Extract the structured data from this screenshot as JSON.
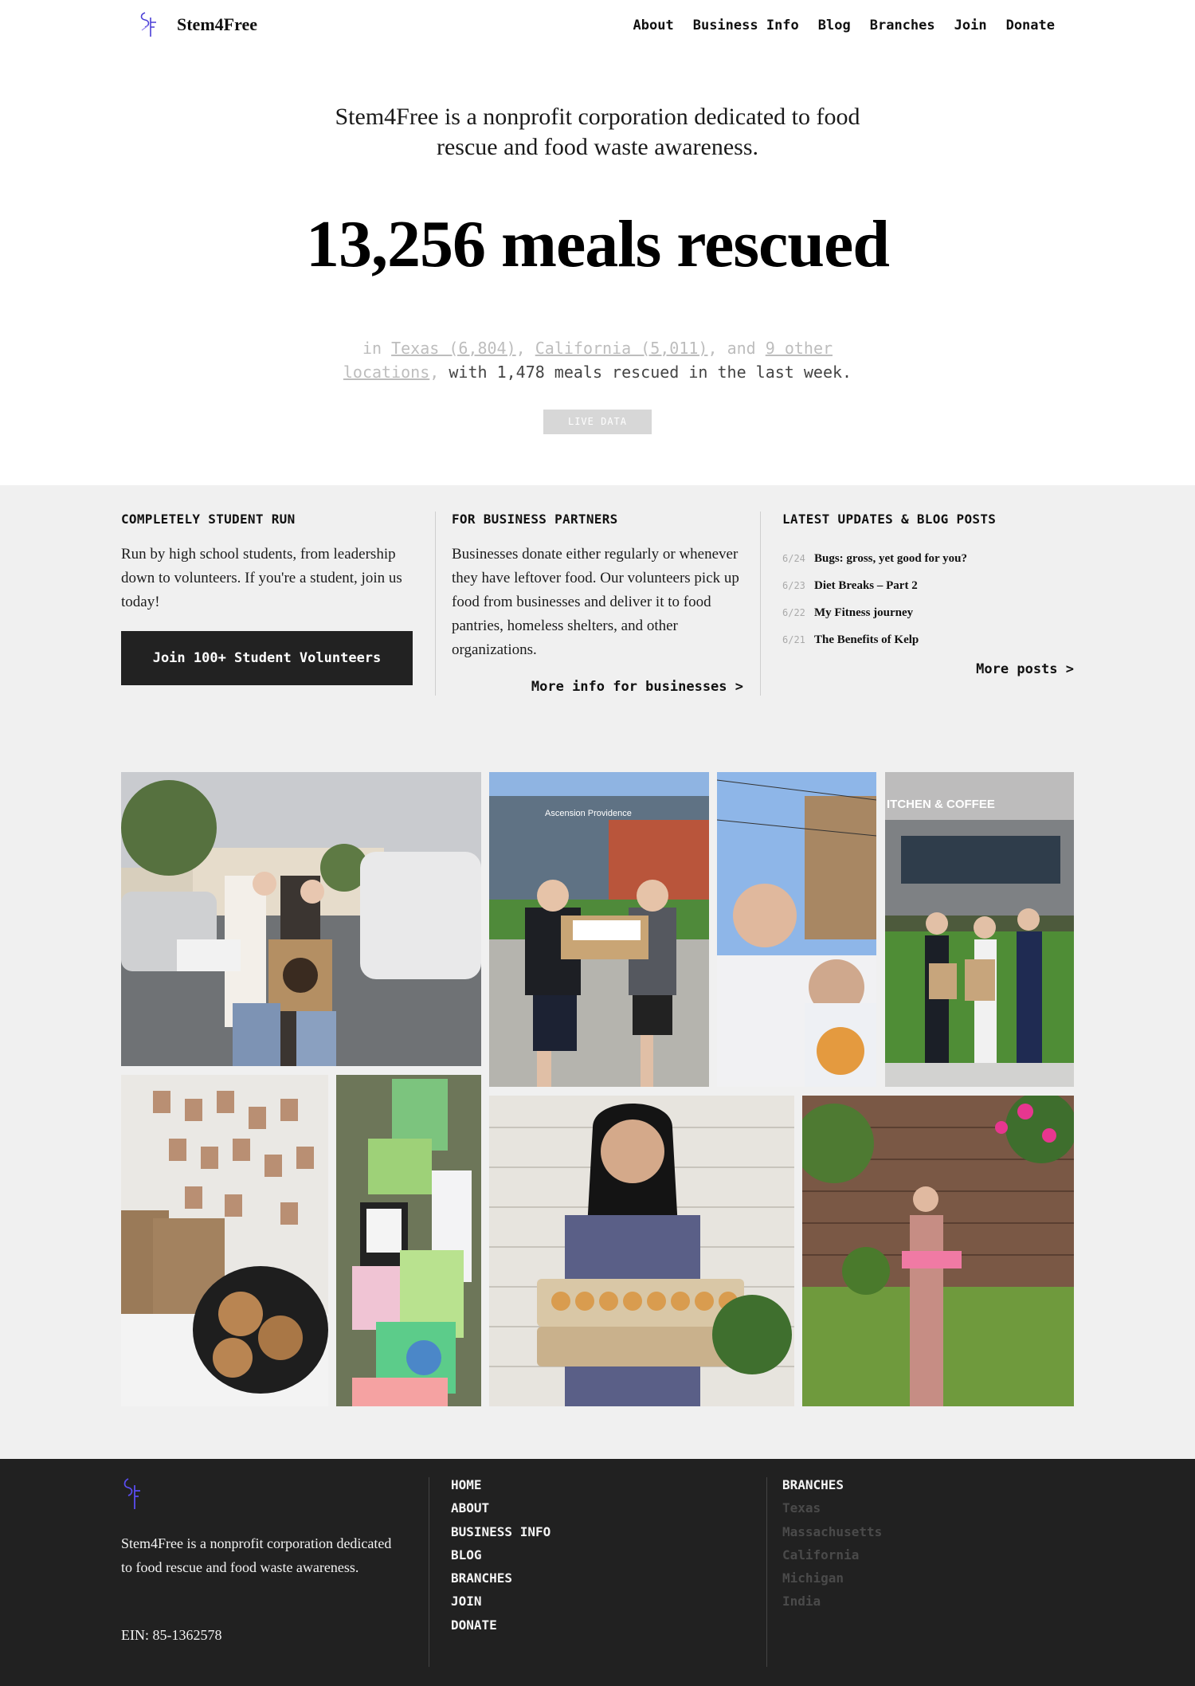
{
  "header": {
    "brand": "Stem4Free",
    "nav": [
      "About",
      "Business Info",
      "Blog",
      "Branches",
      "Join",
      "Donate"
    ]
  },
  "hero": {
    "tagline": "Stem4Free is a nonprofit corporation dedicated to food rescue and food waste awareness.",
    "meals_headline": "13,256 meals rescued",
    "locations_prefix": "in ",
    "location_1": "Texas (6,804)",
    "sep_1": ", ",
    "location_2": "California (5,011)",
    "sep_2": ", and ",
    "location_other": "9 other locations",
    "sep_3": ", ",
    "weekly": "with 1,478 meals rescued in the last week.",
    "badge": "LIVE DATA"
  },
  "columns": {
    "students": {
      "heading": "COMPLETELY STUDENT RUN",
      "body": "Run by high school students, from leadership down to volunteers. If you're a student, join us today!",
      "cta": "Join 100+ Student Volunteers"
    },
    "business": {
      "heading": "FOR BUSINESS PARTNERS",
      "body": "Businesses donate either regularly or whenever they have leftover food. Our volunteers pick up food from businesses and deliver it to food pantries, homeless shelters, and other organizations.",
      "link": "More info for businesses >"
    },
    "updates": {
      "heading": "LATEST UPDATES & BLOG POSTS",
      "posts": [
        {
          "date": "6/24",
          "title": "Bugs: gross, yet good for you?"
        },
        {
          "date": "6/23",
          "title": "Diet Breaks – Part 2"
        },
        {
          "date": "6/22",
          "title": "My Fitness journey"
        },
        {
          "date": "6/21",
          "title": "The Benefits of Kelp"
        }
      ],
      "link": "More posts >"
    }
  },
  "photos": {
    "sign_1": "Ascension Providence",
    "sign_2": "ITCHEN & COFFEE"
  },
  "footer": {
    "description": "Stem4Free is a nonprofit corporation dedicated to food rescue and food waste awareness.",
    "ein": "EIN: 85-1362578",
    "links": [
      "HOME",
      "ABOUT",
      "BUSINESS INFO",
      "BLOG",
      "BRANCHES",
      "JOIN",
      "DONATE"
    ],
    "branches_heading": "BRANCHES",
    "branches": [
      "Texas",
      "Massachusetts",
      "California",
      "Michigan",
      "India"
    ]
  },
  "colors": {
    "footer_bg": "#212121",
    "section_bg": "#f0f0f0",
    "cta_bg": "#222222",
    "logo_accent": "#4b3fd6"
  }
}
